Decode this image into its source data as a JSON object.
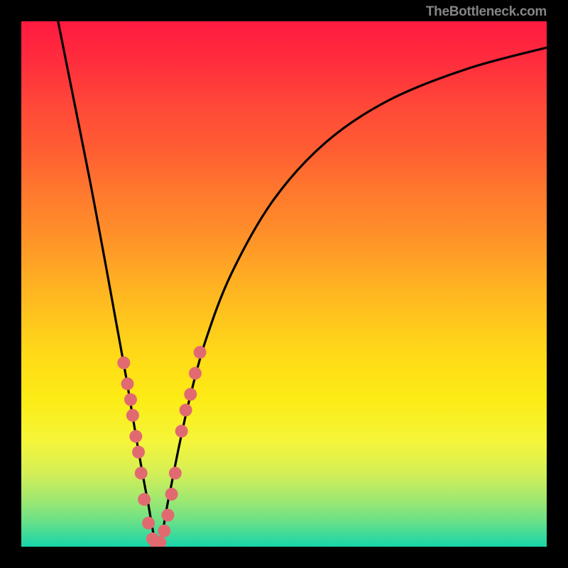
{
  "attribution": "TheBottleneck.com",
  "chart_data": {
    "type": "line",
    "title": "",
    "xlabel": "",
    "ylabel": "",
    "xlim": [
      0,
      100
    ],
    "ylim": [
      0,
      100
    ],
    "vertex_x": 26,
    "series": [
      {
        "name": "bottleneck-curve",
        "x": [
          7,
          10,
          13,
          16,
          18,
          20,
          22,
          24,
          26,
          28,
          30,
          32,
          35,
          40,
          48,
          58,
          70,
          85,
          100
        ],
        "y": [
          100,
          85,
          70,
          54,
          43,
          32,
          20,
          9,
          0,
          9,
          19,
          28,
          39,
          52,
          66,
          77,
          85,
          91,
          95
        ]
      }
    ],
    "scatter_points": {
      "name": "data-markers",
      "x": [
        19.5,
        20.2,
        20.8,
        21.2,
        21.8,
        22.3,
        22.8,
        23.4,
        24.2,
        25.0,
        25.7,
        26.4,
        27.2,
        27.9,
        28.6,
        29.3,
        30.5,
        31.3,
        32.2,
        33.1,
        34.0
      ],
      "y": [
        35,
        31,
        28,
        25,
        21,
        18,
        14,
        9,
        4.5,
        1.5,
        0.5,
        0.8,
        3,
        6,
        10,
        14,
        22,
        26,
        29,
        33,
        37
      ]
    },
    "colors": {
      "curve": "#000000",
      "points": "#e16a71",
      "gradient_top": "#ff1a40",
      "gradient_bottom": "#1ad4a8"
    }
  }
}
